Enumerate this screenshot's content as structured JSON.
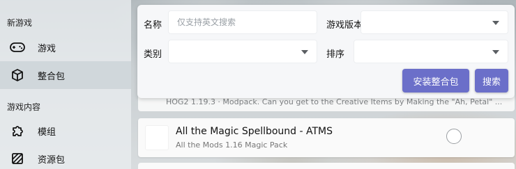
{
  "sidebar": {
    "section_new_game": "新游戏",
    "items_top": [
      {
        "label": "游戏",
        "icon": "gamepad-icon"
      },
      {
        "label": "整合包",
        "icon": "package-icon"
      }
    ],
    "section_game_content": "游戏内容",
    "items_bottom": [
      {
        "label": "模组",
        "icon": "puzzle-icon"
      },
      {
        "label": "资源包",
        "icon": "texture-icon"
      }
    ],
    "active_item": "整合包"
  },
  "filters": {
    "name_label": "名称",
    "name_placeholder": "仅支持英文搜索",
    "game_version_label": "游戏版本",
    "game_version_value": "",
    "category_label": "类别",
    "category_value": "",
    "sort_label": "排序",
    "sort_value": "",
    "install_button": "安装整合包",
    "search_button": "搜索"
  },
  "list": {
    "peek_text": "HOG2 1.19.3 · Modpack. Can you get to the Creative Items by Making the \"Ah, Petal\" ...",
    "items": [
      {
        "title": "All the Magic Spellbound - ATMS",
        "subtitle": "All the Mods 1.16 Magic Pack",
        "selected": false
      }
    ]
  },
  "colors": {
    "accent": "#6b6fc9",
    "sidebar_bg": "#e8ecee",
    "card_bg": "#f6f7f9"
  }
}
